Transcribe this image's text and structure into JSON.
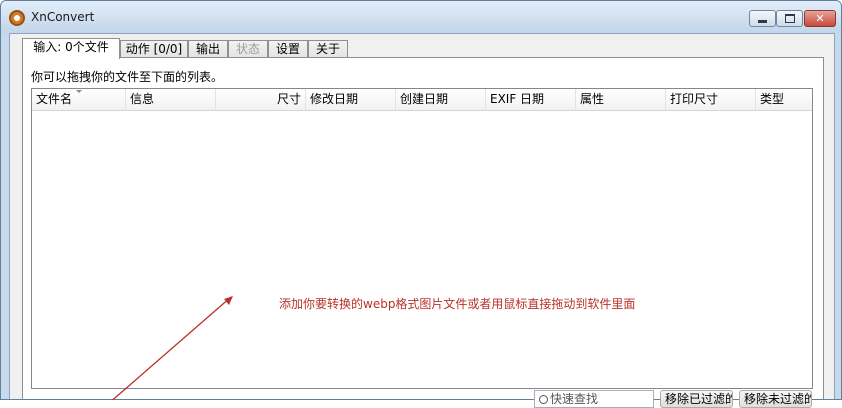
{
  "window": {
    "title": "XnConvert",
    "icon": "xnconvert-gear-icon"
  },
  "tabs": [
    {
      "label": "输入:  0个文件",
      "active": true
    },
    {
      "label": "动作 [0/0]"
    },
    {
      "label": "输出"
    },
    {
      "label": "状态",
      "disabled": true
    },
    {
      "label": "设置"
    },
    {
      "label": "关于"
    }
  ],
  "input_panel": {
    "hint": "你可以拖拽你的文件至下面的列表。",
    "columns": [
      "文件名",
      "信息",
      "尺寸",
      "修改日期",
      "创建日期",
      "EXIF 日期",
      "属性",
      "打印尺寸",
      "类型"
    ],
    "instruction": "添加你要转换的webp格式图片文件或者用鼠标直接拖动到软件里面"
  },
  "bottom": {
    "search_placeholder": "快速查找",
    "remove_filtered": "移除已过滤的",
    "remove_unfiltered": "移除未过滤的"
  },
  "colors": {
    "annotation": "#b8322a",
    "title_bar": "#c9d9ec"
  }
}
